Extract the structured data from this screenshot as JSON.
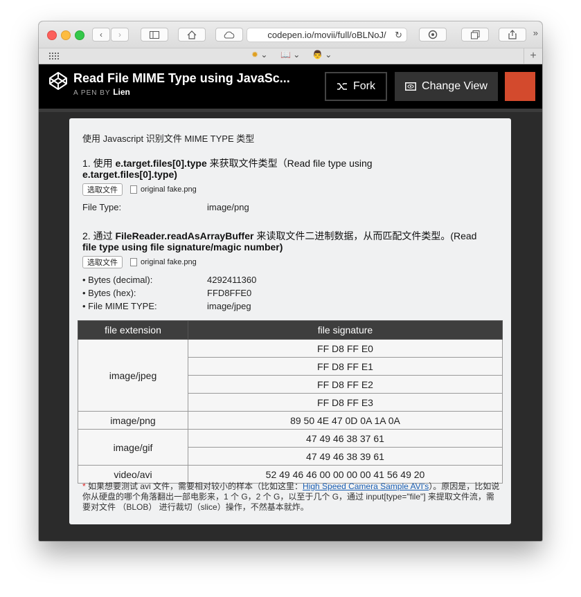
{
  "browser": {
    "url": "codepen.io/movii/full/oBLNoJ/"
  },
  "header": {
    "title": "Read File MIME Type using JavaSc...",
    "byline_prefix": "A PEN BY",
    "author": "Lien",
    "fork_label": "Fork",
    "change_view_label": "Change View"
  },
  "content": {
    "intro": "使用 Javascript 识别文件 MIME TYPE 类型",
    "section1": {
      "heading_prefix": "1. 使用 ",
      "heading_code": "e.target.files[0].type",
      "heading_mid": " 来获取文件类型（Read file type using",
      "heading_line2": "e.target.files[0].type)",
      "button_label": "选取文件",
      "file_name": "original fake.png",
      "result_label": "File Type:",
      "result_value": "image/png"
    },
    "section2": {
      "heading_prefix": "2. 通过 ",
      "heading_code": "FileReader.readAsArrayBuffer",
      "heading_mid": " 来读取文件二进制数据，从而匹配文件类型。(Read",
      "heading_line2": "file type using file signature/magic number)",
      "button_label": "选取文件",
      "file_name": "original fake.png",
      "rows": [
        {
          "label": "• Bytes (decimal):",
          "value": "4292411360"
        },
        {
          "label": "• Bytes (hex):",
          "value": "FFD8FFE0"
        },
        {
          "label": "• File MIME TYPE:",
          "value": "image/jpeg"
        }
      ]
    },
    "table": {
      "headers": [
        "file extension",
        "file signature"
      ],
      "groups": [
        {
          "ext": "image/jpeg",
          "sigs": [
            "FF D8 FF E0",
            "FF D8 FF E1",
            "FF D8 FF E2",
            "FF D8 FF E3"
          ]
        },
        {
          "ext": "image/png",
          "sigs": [
            "89 50 4E 47 0D 0A 1A 0A"
          ]
        },
        {
          "ext": "image/gif",
          "sigs": [
            "47 49 46 38 37 61",
            "47 49 46 38 39 61"
          ]
        },
        {
          "ext": "video/avi",
          "sigs": [
            "52 49 46 46 00 00 00 00 41 56 49 20"
          ]
        }
      ]
    },
    "note": {
      "star": "*",
      "before_link": " 如果想要测试 avi 文件，需要相对较小的样本（比如这里：",
      "link": "High Speed Camera Sample AVI's",
      "after_link": "）。原因是，比如说你从硬盘的哪个角落翻出一部电影来，1 个 G，2 个 G，以至于几个 G，通过 input[type=\"file\"] 来提取文件流，需要对文件 （BLOB） 进行裁切（slice）操作，不然基本就炸。"
    }
  }
}
